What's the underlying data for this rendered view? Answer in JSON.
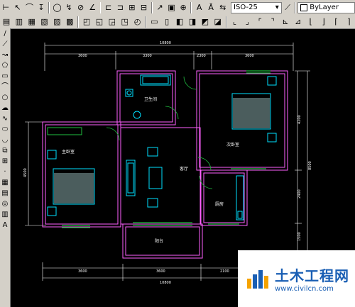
{
  "toolbar": {
    "dimstyle_value": "ISO-25",
    "layer_value": "ByLayer"
  },
  "drawing": {
    "rooms": {
      "bathroom": "卫生间",
      "bedroom_master": "主卧室",
      "bedroom_second": "次卧室",
      "living": "客厅",
      "kitchen": "厨房",
      "balcony": "阳台"
    },
    "dims": {
      "top_total": "10800",
      "top_a": "3600",
      "top_b": "3300",
      "top_c": "2300",
      "top_d": "3600",
      "bottom_a": "3600",
      "bottom_b": "3600",
      "bottom_c": "2100",
      "bottom_total": "10800",
      "left": "4500",
      "right_a": "4200",
      "right_b": "2400",
      "right_c": "1500",
      "right_total": "8500"
    }
  },
  "watermark": {
    "title": "土木工程网",
    "url": "www.civilcn.com"
  }
}
